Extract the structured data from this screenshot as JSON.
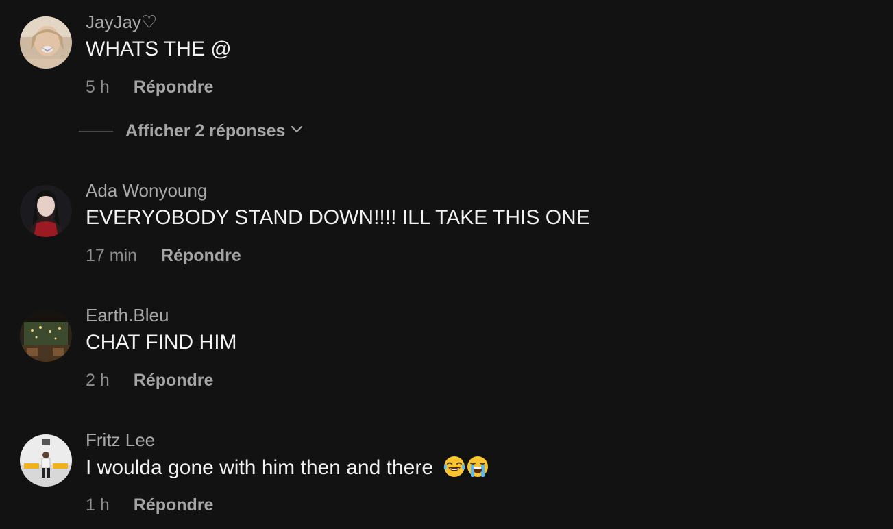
{
  "comments": [
    {
      "username": "JayJay♡",
      "text": "WHATS THE @",
      "time": "5 h",
      "reply_label": "Répondre",
      "avatar_icon": "profile-photo"
    },
    {
      "username": "Ada Wonyoung",
      "text": "EVERYOBODY STAND DOWN!!!! ILL TAKE THIS ONE",
      "time": "17 min",
      "reply_label": "Répondre",
      "avatar_icon": "profile-photo"
    },
    {
      "username": "Earth.Bleu",
      "text": "CHAT FIND HIM",
      "time": "2 h",
      "reply_label": "Répondre",
      "avatar_icon": "profile-photo"
    },
    {
      "username": "Fritz Lee",
      "text": "I woulda gone with him then and there",
      "time": "1 h",
      "reply_label": "Répondre",
      "avatar_icon": "profile-photo",
      "emojis": [
        "😂",
        "😭"
      ]
    }
  ],
  "view_replies": {
    "label": "Afficher 2 réponses",
    "icon": "chevron-down-icon"
  },
  "colors": {
    "background": "#121212",
    "username": "#a9a9a9",
    "text": "#f2f2f2",
    "meta": "#8f8f8f"
  }
}
